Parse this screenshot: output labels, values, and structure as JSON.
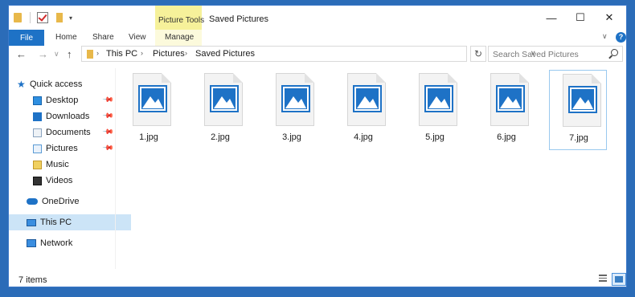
{
  "window": {
    "title": "Saved Pictures",
    "contextual_tab_group": "Picture Tools",
    "controls": {
      "minimize": "—",
      "maximize": "☐",
      "close": "✕"
    }
  },
  "quick_access_toolbar": {
    "dropdown": "▾"
  },
  "ribbon": {
    "tabs": [
      "File",
      "Home",
      "Share",
      "View",
      "Manage"
    ],
    "help": "?",
    "collapse": "∨"
  },
  "navigation": {
    "back": "←",
    "forward": "→",
    "recent": "∨",
    "up": "↑",
    "breadcrumb": [
      "This PC",
      "Pictures",
      "Saved Pictures"
    ],
    "breadcrumb_separator": "›",
    "address_dropdown": "∨",
    "refresh": "↻",
    "search_placeholder": "Search Saved Pictures"
  },
  "sidebar": {
    "quick_access": "Quick access",
    "pinned": [
      {
        "label": "Desktop",
        "pinned": true,
        "icon": "desktop-icon"
      },
      {
        "label": "Downloads",
        "pinned": true,
        "icon": "downloads-icon"
      },
      {
        "label": "Documents",
        "pinned": true,
        "icon": "documents-icon"
      },
      {
        "label": "Pictures",
        "pinned": true,
        "icon": "pictures-icon"
      },
      {
        "label": "Music",
        "pinned": false,
        "icon": "music-icon"
      },
      {
        "label": "Videos",
        "pinned": false,
        "icon": "videos-icon"
      }
    ],
    "onedrive": "OneDrive",
    "this_pc": "This PC",
    "network": "Network",
    "pin_glyph": "📌"
  },
  "files": [
    {
      "name": "1.jpg",
      "selected": false
    },
    {
      "name": "2.jpg",
      "selected": false
    },
    {
      "name": "3.jpg",
      "selected": false
    },
    {
      "name": "4.jpg",
      "selected": false
    },
    {
      "name": "5.jpg",
      "selected": false
    },
    {
      "name": "6.jpg",
      "selected": false
    },
    {
      "name": "7.jpg",
      "selected": true
    }
  ],
  "status": {
    "item_count": "7 items"
  },
  "colors": {
    "accent": "#1e72c6",
    "selection": "#cce4f7",
    "contextual_tab": "#f6f19a",
    "frame": "#2b6cb8"
  }
}
